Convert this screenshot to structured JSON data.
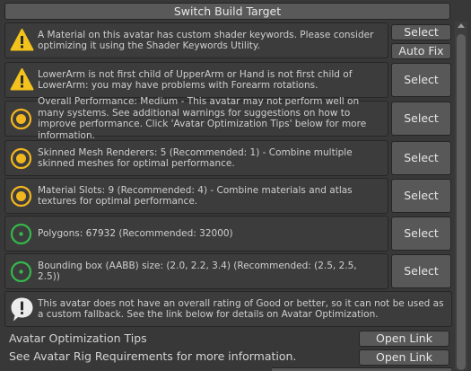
{
  "toolbar": {
    "switch_build_target": "Switch Build Target"
  },
  "colors": {
    "warning": "#f3c21c",
    "performance": "#f2b61e",
    "good": "#35b84b",
    "info": "#ececec"
  },
  "messages": [
    {
      "icon": "warning-triangle-icon",
      "text": "A Material on this avatar has custom shader keywords. Please consider optimizing it using the Shader Keywords Utility.",
      "buttons": [
        "Select",
        "Auto Fix"
      ]
    },
    {
      "icon": "warning-triangle-icon",
      "text": "LowerArm is not first child of UpperArm or Hand is not first child of LowerArm: you may have problems with Forearm rotations.",
      "buttons": [
        "Select"
      ]
    },
    {
      "icon": "performance-medium-icon",
      "text": "Overall Performance: Medium - This avatar may not perform well on many systems. See additional warnings for suggestions on how to improve performance. Click 'Avatar Optimization Tips' below for more information.",
      "buttons": [
        "Select"
      ]
    },
    {
      "icon": "performance-medium-icon",
      "text": "Skinned Mesh Renderers: 5 (Recommended: 1) - Combine multiple skinned meshes for optimal performance.",
      "buttons": [
        "Select"
      ]
    },
    {
      "icon": "performance-medium-icon",
      "text": "Material Slots: 9 (Recommended: 4) - Combine materials and atlas textures for optimal performance.",
      "buttons": [
        "Select"
      ]
    },
    {
      "icon": "performance-good-icon",
      "text": "Polygons: 67932 (Recommended: 32000)",
      "buttons": [
        "Select"
      ]
    },
    {
      "icon": "performance-good-icon",
      "text": "Bounding box (AABB) size: (2.0, 2.2, 3.4) (Recommended: (2.5, 2.5, 2.5))",
      "buttons": [
        "Select"
      ]
    },
    {
      "icon": "info-exclamation-icon",
      "text": "This avatar does not have an overall rating of Good or better, so it can not be used as a custom fallback. See the link below for details on Avatar Optimization.",
      "buttons": []
    }
  ],
  "tips": {
    "title": "Avatar Optimization Tips",
    "rig_text": "See Avatar Rig Requirements for more information.",
    "open_link": "Open Link"
  }
}
